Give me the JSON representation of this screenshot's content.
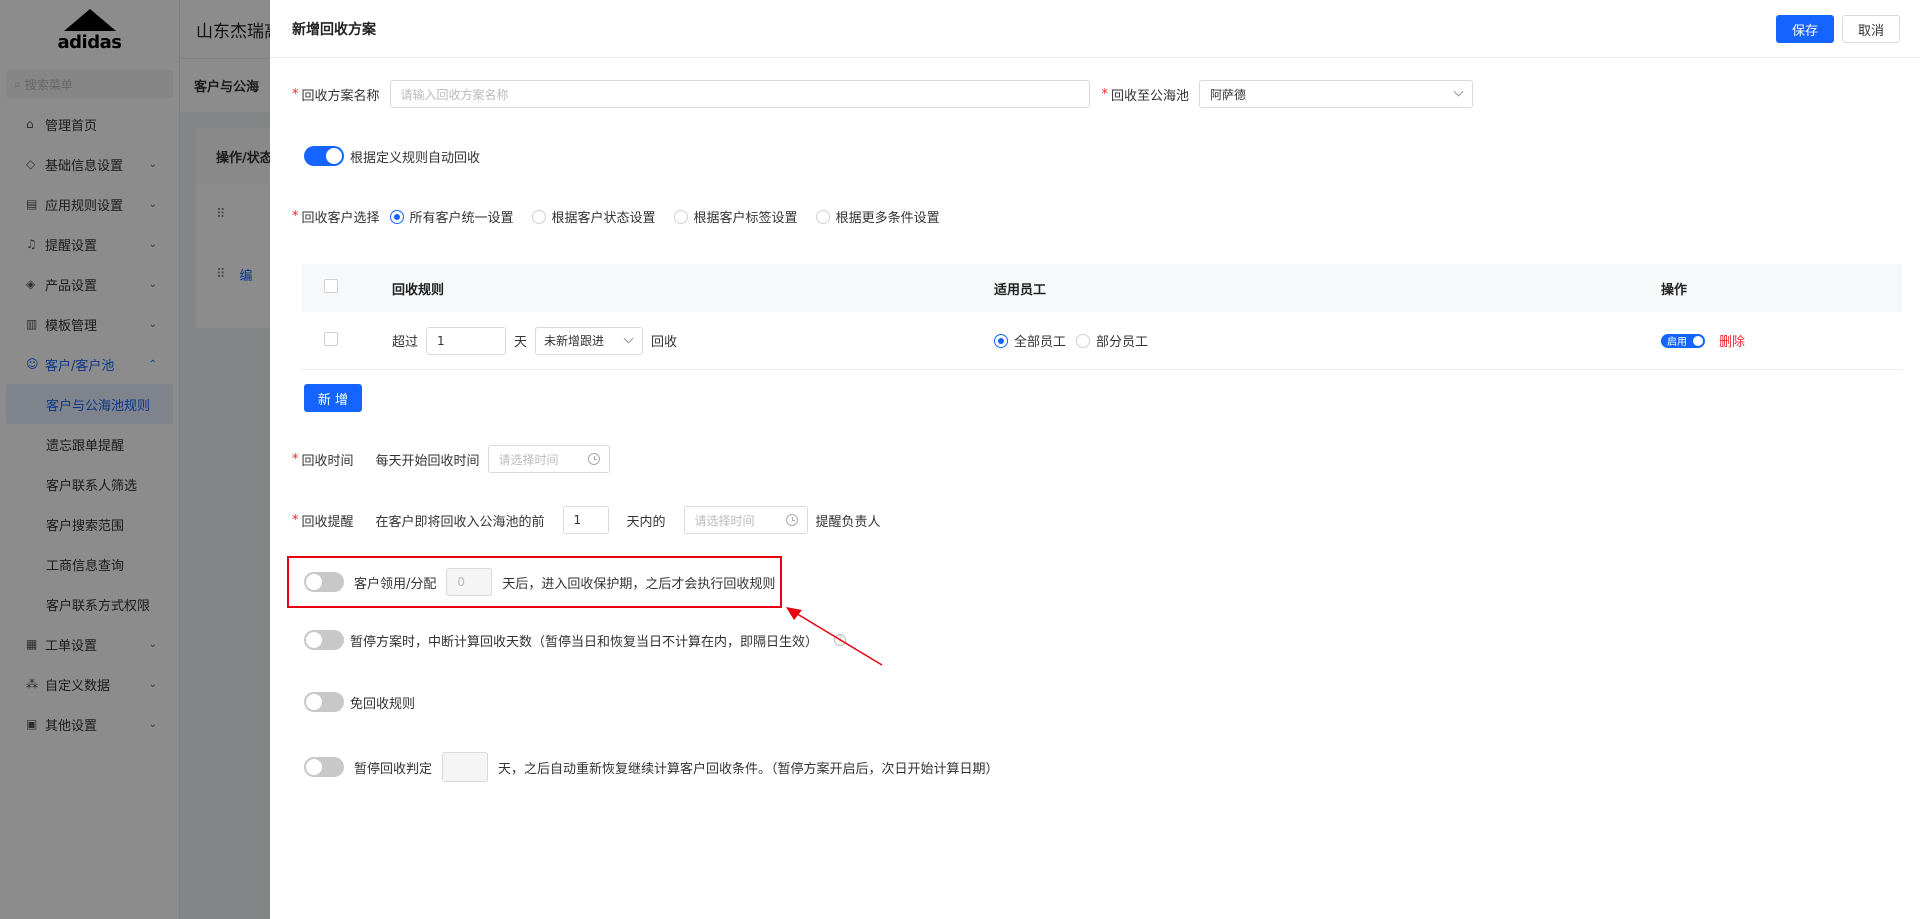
{
  "sidebar": {
    "search_placeholder": "搜索菜单",
    "items": [
      {
        "label": "管理首页"
      },
      {
        "label": "基础信息设置"
      },
      {
        "label": "应用规则设置"
      },
      {
        "label": "提醒设置"
      },
      {
        "label": "产品设置"
      },
      {
        "label": "模板管理"
      },
      {
        "label": "客户/客户池"
      }
    ],
    "subitems": [
      {
        "label": "客户与公海池规则"
      },
      {
        "label": "遗忘跟单提醒"
      },
      {
        "label": "客户联系人筛选"
      },
      {
        "label": "客户搜索范围"
      },
      {
        "label": "工商信息查询"
      },
      {
        "label": "客户联系方式权限"
      }
    ],
    "items_after": [
      {
        "label": "工单设置"
      },
      {
        "label": "自定义数据"
      },
      {
        "label": "其他设置"
      }
    ]
  },
  "background": {
    "company": "山东杰瑞高",
    "breadcrumb": "客户与公海",
    "table_header": "操作/状态",
    "row_link": "编"
  },
  "drawer": {
    "title": "新增回收方案",
    "save_label": "保存",
    "cancel_label": "取消",
    "plan_name_label": "回收方案名称",
    "plan_name_placeholder": "请输入回收方案名称",
    "pool_label": "回收至公海池",
    "pool_value": "阿萨德",
    "auto_recycle_label": "根据定义规则自动回收",
    "auto_recycle_on": true,
    "customer_select_label": "回收客户选择",
    "customer_options": [
      {
        "label": "所有客户统一设置",
        "checked": true
      },
      {
        "label": "根据客户状态设置",
        "checked": false
      },
      {
        "label": "根据客户标签设置",
        "checked": false
      },
      {
        "label": "根据更多条件设置",
        "checked": false
      }
    ],
    "table": {
      "headers": {
        "rule": "回收规则",
        "staff": "适用员工",
        "ops": "操作"
      },
      "row": {
        "exceed": "超过",
        "days_value": "1",
        "day_unit": "天",
        "condition": "未新增跟进",
        "recycle": "回收",
        "staff_all": "全部员工",
        "staff_part": "部分员工",
        "enable": "启用",
        "delete": "删除"
      }
    },
    "add_label": "新 增",
    "recycle_time_label": "回收时间",
    "recycle_time_text": "每天开始回收时间",
    "time_placeholder": "请选择时间",
    "remind_label": "回收提醒",
    "remind_text1": "在客户即将回收入公海池的前",
    "remind_days": "1",
    "remind_text2": "天内的",
    "remind_text3": "提醒负责人",
    "claim_label": "客户领用/分配",
    "claim_days": "0",
    "claim_text": "天后，进入回收保护期，之后才会执行回收规则",
    "pause_label": "暂停方案时，中断计算回收天数（暂停当日和恢复当日不计算在内，即隔日生效）",
    "exempt_label": "免回收规则",
    "pause_judge_label": "暂停回收判定",
    "pause_judge_text": "天，之后自动重新恢复继续计算客户回收条件。（暂停方案开启后，次日开始计算日期）",
    "help_icon": "?"
  },
  "colors": {
    "primary": "#1664ff",
    "danger": "#f5222d",
    "annotation": "#e60012"
  }
}
